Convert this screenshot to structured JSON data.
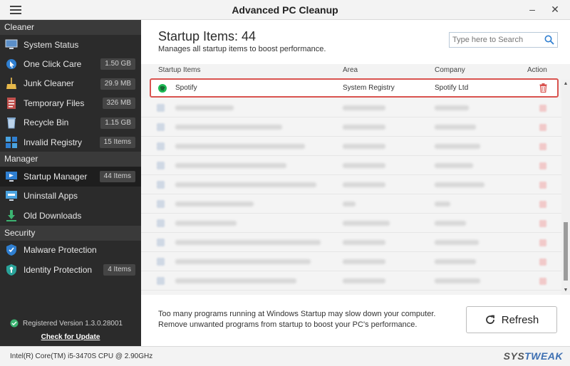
{
  "app": {
    "title": "Advanced PC Cleanup"
  },
  "sidebar": {
    "sections": [
      {
        "label": "Cleaner"
      },
      {
        "label": "Manager"
      },
      {
        "label": "Security"
      }
    ],
    "items": [
      {
        "label": "System Status",
        "badge": ""
      },
      {
        "label": "One Click Care",
        "badge": "1.50 GB"
      },
      {
        "label": "Junk Cleaner",
        "badge": "29.9 MB"
      },
      {
        "label": "Temporary Files",
        "badge": "326 MB"
      },
      {
        "label": "Recycle Bin",
        "badge": "1.15 GB"
      },
      {
        "label": "Invalid Registry",
        "badge": "15 Items"
      },
      {
        "label": "Startup Manager",
        "badge": "44 Items"
      },
      {
        "label": "Uninstall Apps",
        "badge": ""
      },
      {
        "label": "Old Downloads",
        "badge": ""
      },
      {
        "label": "Malware Protection",
        "badge": ""
      },
      {
        "label": "Identity Protection",
        "badge": "4 Items"
      }
    ],
    "registered": "Registered Version 1.3.0.28001",
    "check_update": "Check for Update"
  },
  "main": {
    "title": "Startup Items: 44",
    "subtitle": "Manages all startup items to boost performance.",
    "search_placeholder": "Type here to Search",
    "columns": {
      "name": "Startup Items",
      "area": "Area",
      "company": "Company",
      "action": "Action"
    },
    "highlighted_row": {
      "name": "Spotify",
      "area": "System Registry",
      "company": "Spotify Ltd"
    },
    "notice_line1": "Too many programs running at Windows Startup may slow down your computer.",
    "notice_line2": "Remove unwanted programs from startup to boost your PC's performance.",
    "refresh_label": "Refresh"
  },
  "statusbar": {
    "cpu": "Intel(R) Core(TM) i5-3470S CPU @ 2.90GHz",
    "brand_a": "SYS",
    "brand_b": "TWEAK"
  },
  "colors": {
    "accent_red": "#d9534f",
    "spotify_green": "#1db954",
    "sidebar_bg": "#2b2b2b"
  }
}
